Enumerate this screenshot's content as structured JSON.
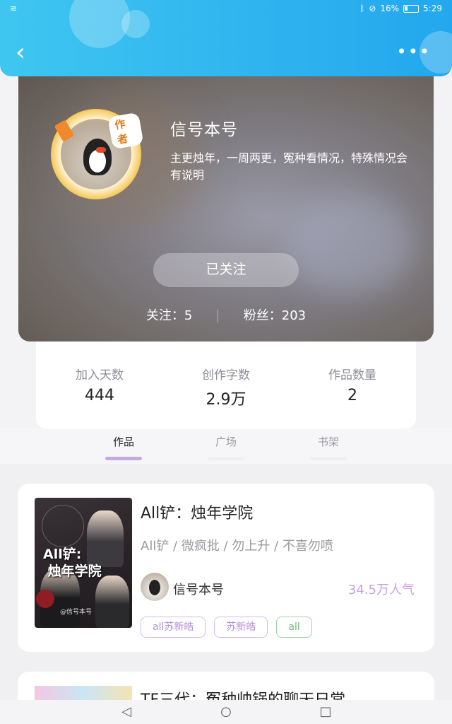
{
  "status_bar": {
    "battery": "16%",
    "time": "5:29"
  },
  "profile": {
    "name": "信号本号",
    "bio": "主更烛年，一周两更，冤种看情况，特殊情况会有说明",
    "author_badge": "作者",
    "follow_button": "已关注",
    "following_label": "关注：",
    "following_count": "5",
    "fans_label": "粉丝：",
    "fans_count": "203"
  },
  "stats": [
    {
      "label": "加入天数",
      "value": "444"
    },
    {
      "label": "创作字数",
      "value": "2.9万"
    },
    {
      "label": "作品数量",
      "value": "2"
    }
  ],
  "tabs": [
    {
      "label": "作品",
      "active": true
    },
    {
      "label": "广场",
      "active": false
    },
    {
      "label": "书架",
      "active": false
    }
  ],
  "works": [
    {
      "cover_title": "All铲:\n烛年学院",
      "cover_author": "@信号本号",
      "title": "All铲：烛年学院",
      "tags_line": "All铲 / 微疯批 / 勿上升 / 不喜勿喷",
      "author": "信号本号",
      "popularity": "34.5万人气",
      "chips": [
        "all苏新皓",
        "苏新皓",
        "all"
      ]
    },
    {
      "title": "TF三代：冤种帅锅的聊天日常"
    }
  ],
  "colors": {
    "header": "#2fb3ef",
    "accent_purple": "#c8a1e4",
    "chip_green": "#6bbd74"
  }
}
